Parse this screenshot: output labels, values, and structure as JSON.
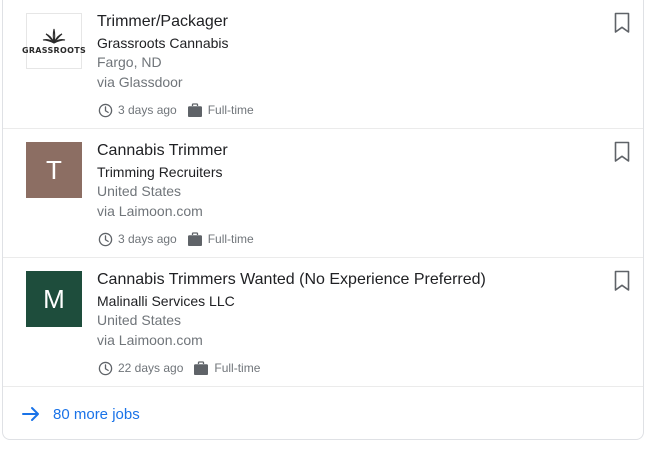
{
  "jobs": [
    {
      "title": "Trimmer/Packager",
      "company": "Grassroots Cannabis",
      "location": "Fargo, ND",
      "via": "via Glassdoor",
      "posted": "3 days ago",
      "type": "Full-time",
      "logo": {
        "kind": "image",
        "text": "GRASSROOTS",
        "icon": "cannabis-leaf-icon"
      }
    },
    {
      "title": "Cannabis Trimmer",
      "company": "Trimming Recruiters",
      "location": "United States",
      "via": "via Laimoon.com",
      "posted": "3 days ago",
      "type": "Full-time",
      "logo": {
        "kind": "letter",
        "text": "T",
        "color": "#8c6e63"
      }
    },
    {
      "title": "Cannabis Trimmers Wanted (No Experience Preferred)",
      "company": "Malinalli Services LLC",
      "location": "United States",
      "via": "via Laimoon.com",
      "posted": "22 days ago",
      "type": "Full-time",
      "logo": {
        "kind": "letter",
        "text": "M",
        "color": "#1e4d3c"
      }
    }
  ],
  "more": {
    "label": "80 more jobs",
    "icon": "arrow-right-icon"
  },
  "colors": {
    "accent": "#1a73e8",
    "secondary_text": "#70757a",
    "primary_text": "#202124"
  }
}
